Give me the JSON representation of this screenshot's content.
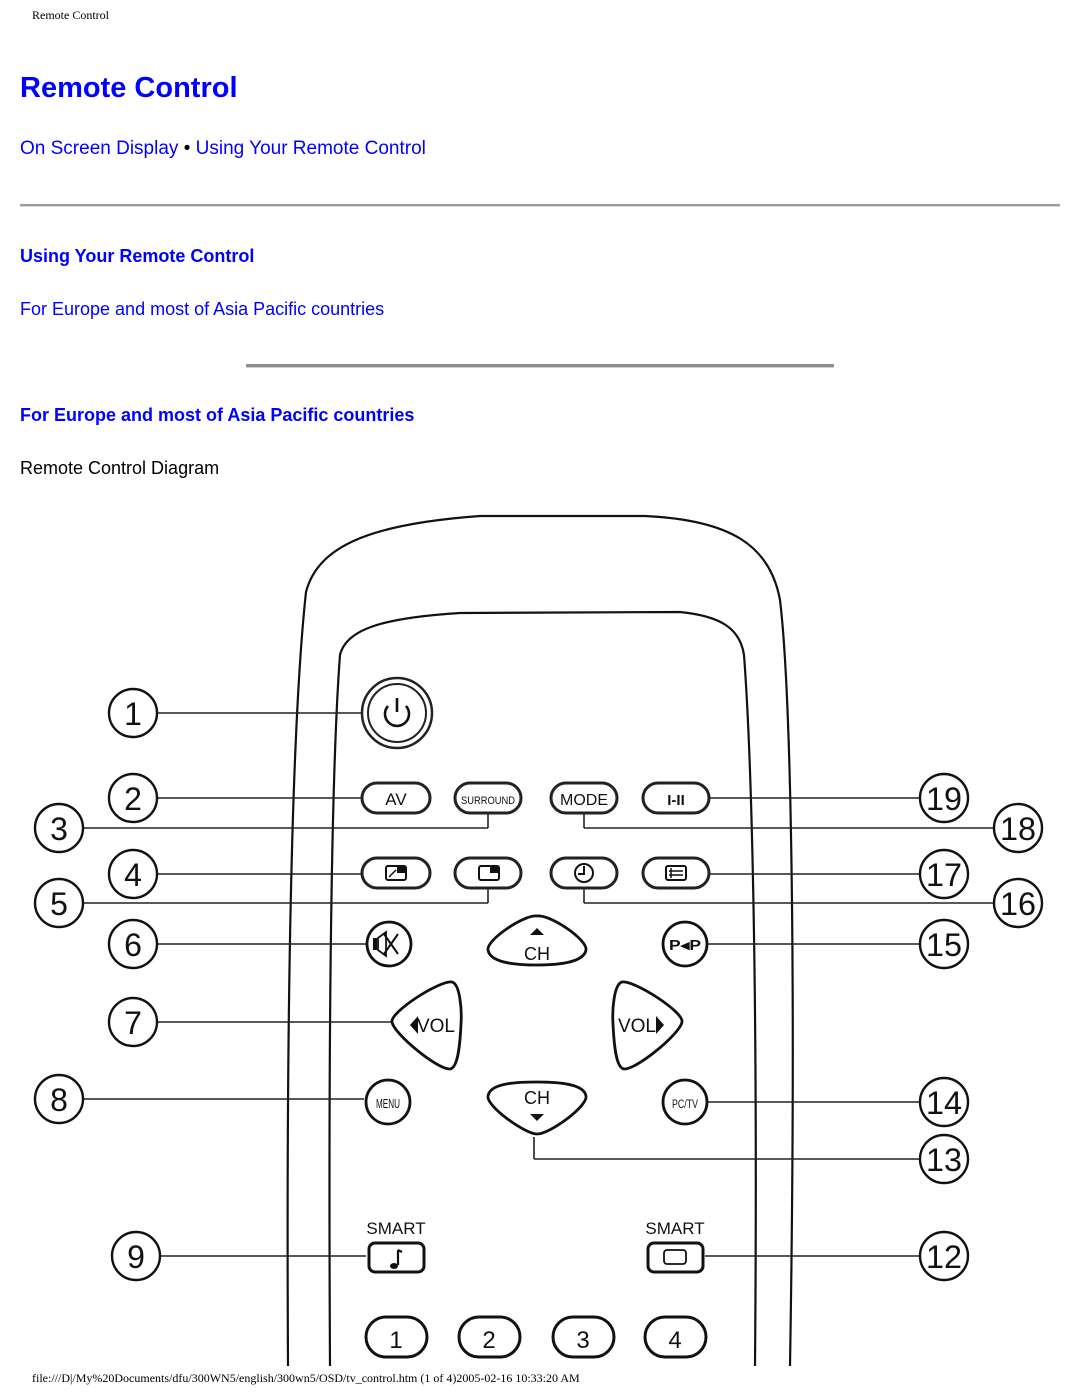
{
  "header": {
    "running_title": "Remote Control"
  },
  "page_title": "Remote Control",
  "nav": {
    "items": [
      {
        "label": "On Screen Display"
      },
      {
        "label": "Using Your Remote Control"
      }
    ],
    "separator": "•"
  },
  "section": {
    "heading": "Using Your Remote Control",
    "link": "For Europe and most of Asia Pacific countries"
  },
  "subsection": {
    "heading": "For Europe and most of Asia Pacific countries",
    "caption": "Remote Control Diagram"
  },
  "diagram": {
    "buttons": {
      "av": "AV",
      "surround": "SURROUND",
      "mode": "MODE",
      "i_ii": "I-II",
      "ch": "CH",
      "vol": "VOL",
      "pip": "P◂P",
      "menu": "MENU",
      "pctv": "PC/TV",
      "smart": "SMART",
      "num1": "1",
      "num2": "2",
      "num3": "3",
      "num4": "4"
    },
    "callouts": [
      "1",
      "2",
      "3",
      "4",
      "5",
      "6",
      "7",
      "8",
      "9",
      "12",
      "13",
      "14",
      "15",
      "16",
      "17",
      "18",
      "19"
    ]
  },
  "footer": {
    "text": "file:///D|/My%20Documents/dfu/300WN5/english/300wn5/OSD/tv_control.htm (1 of 4)2005-02-16 10:33:20 AM"
  }
}
